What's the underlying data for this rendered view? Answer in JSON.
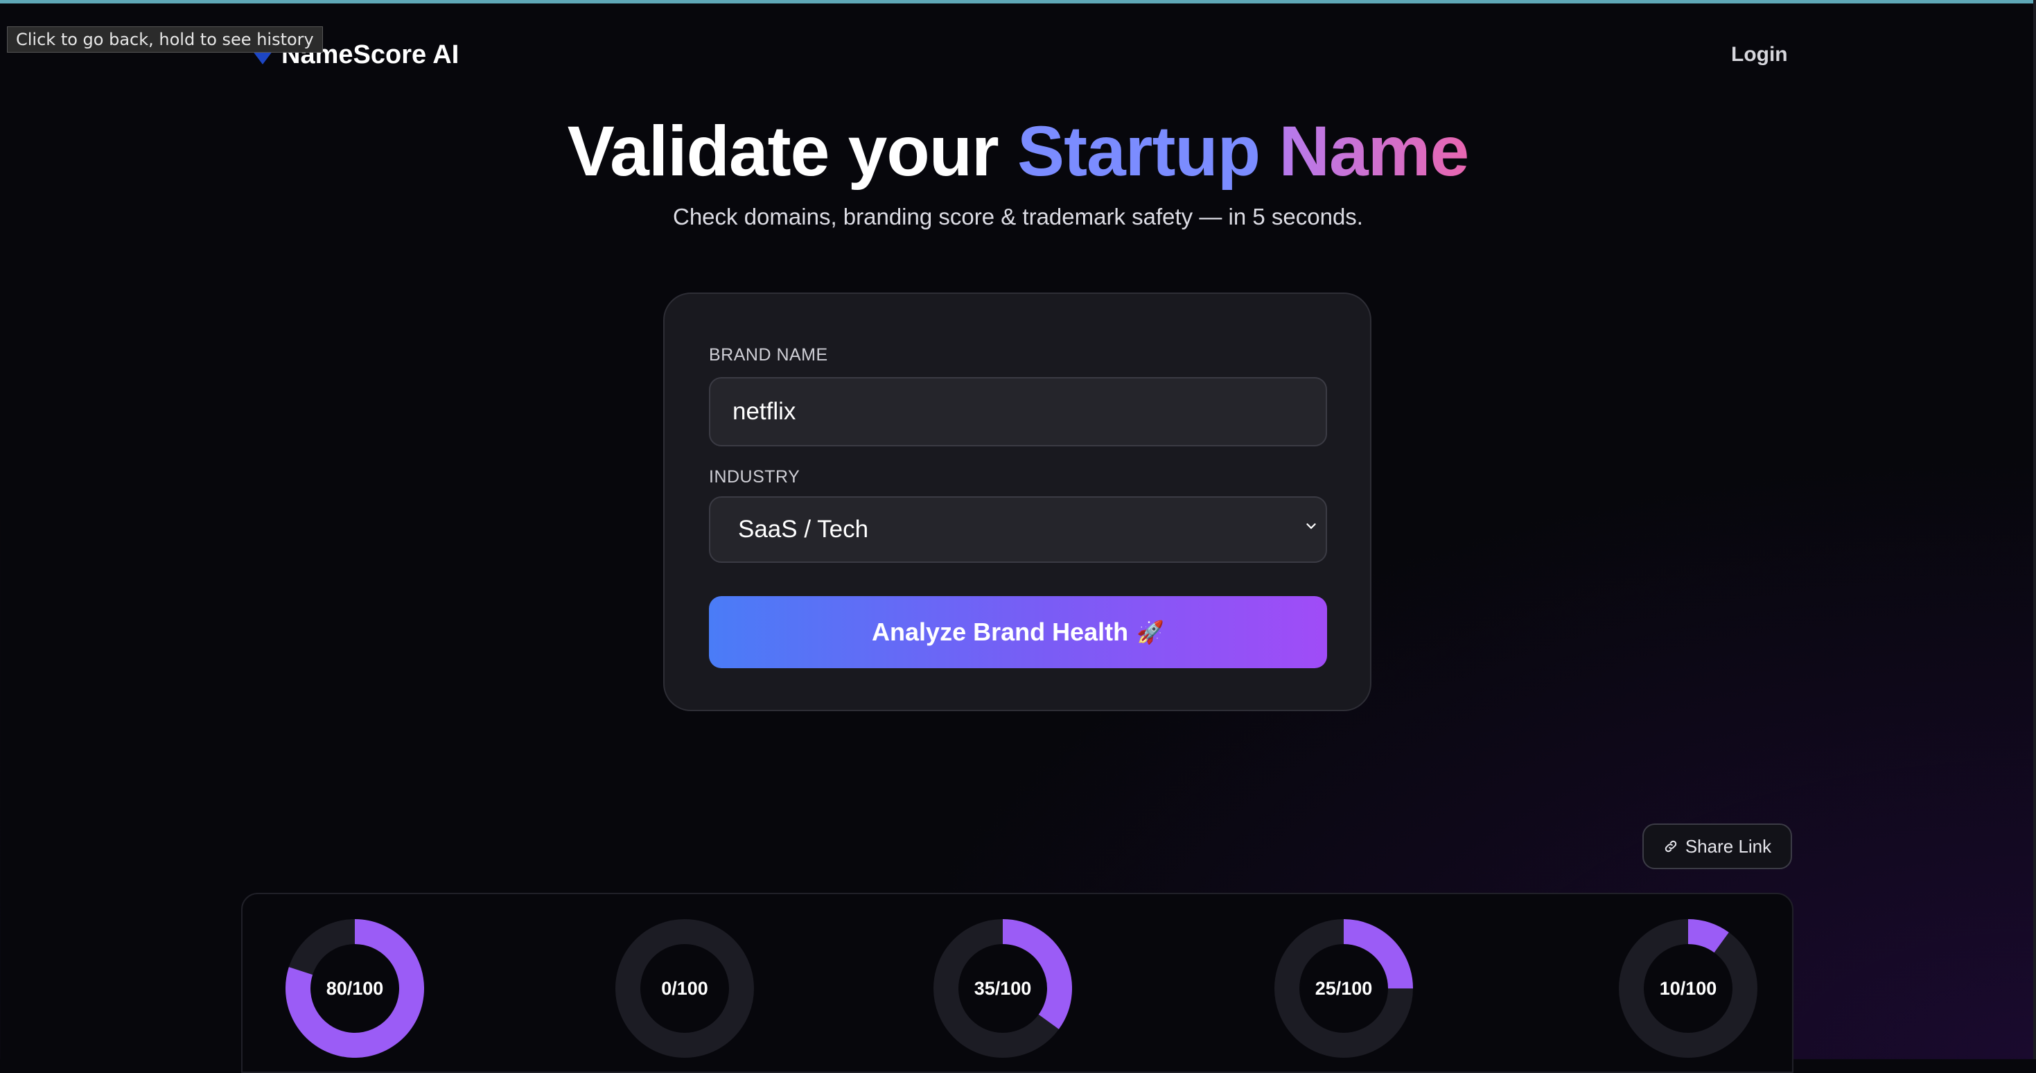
{
  "browser": {
    "tooltip": "Click to go back, hold to see history"
  },
  "nav": {
    "brand": "NameScore AI",
    "login_label": "Login",
    "logo_icon": "diamond-icon"
  },
  "hero": {
    "title_part1": "Validate your",
    "title_part2": "Startup",
    "title_part3": "Name",
    "subtitle": "Check domains, branding score & trademark safety — in 5 seconds."
  },
  "form": {
    "brand_name_label": "BRAND NAME",
    "brand_name_value": "netflix",
    "industry_label": "INDUSTRY",
    "industry_selected": "SaaS / Tech",
    "submit_label": "Analyze Brand Health",
    "submit_emoji": "🚀"
  },
  "share": {
    "label": "Share Link",
    "icon": "link-icon"
  },
  "scores": [
    {
      "label": "80/100",
      "value": 80
    },
    {
      "label": "0/100",
      "value": 0
    },
    {
      "label": "35/100",
      "value": 35
    },
    {
      "label": "25/100",
      "value": 25
    },
    {
      "label": "10/100",
      "value": 10
    }
  ],
  "colors": {
    "accent": "#9b5cf6",
    "track": "#1c1c24",
    "background": "#07070c"
  }
}
